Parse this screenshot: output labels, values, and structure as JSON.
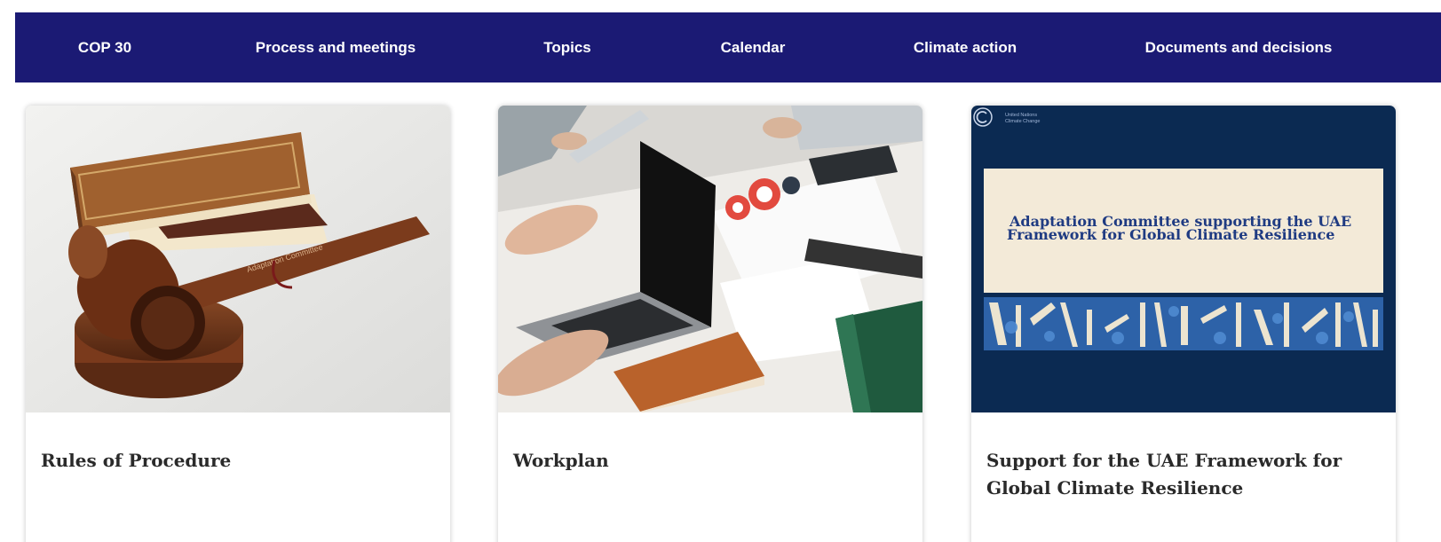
{
  "nav": {
    "items": [
      {
        "label": "COP 30"
      },
      {
        "label": "Process and meetings"
      },
      {
        "label": "Topics"
      },
      {
        "label": "Calendar"
      },
      {
        "label": "Climate action"
      },
      {
        "label": "Documents and decisions"
      }
    ]
  },
  "cards": [
    {
      "title": "Rules of Procedure",
      "image": {
        "description_icon": "gavel-and-books-photo",
        "gavel_text": "Adaptation Committee"
      }
    },
    {
      "title": "Workplan",
      "image": {
        "description_icon": "meeting-laptop-photo"
      }
    },
    {
      "title": "Support for the UAE Framework for Global Climate Resilience",
      "image": {
        "description_icon": "document-cover",
        "banner_line1": "Adaptation Committee supporting the UAE",
        "banner_line2": "Framework for Global Climate Resilience",
        "logo_line1": "United Nations",
        "logo_line2": "Climate Change"
      }
    }
  ],
  "colors": {
    "nav_bg": "#1b1a74",
    "nav_text": "#ffffff",
    "card_title": "#2a2a2a",
    "doc_bg": "#0b2a52",
    "doc_banner": "#f3ead8",
    "doc_title": "#1f3b82"
  }
}
